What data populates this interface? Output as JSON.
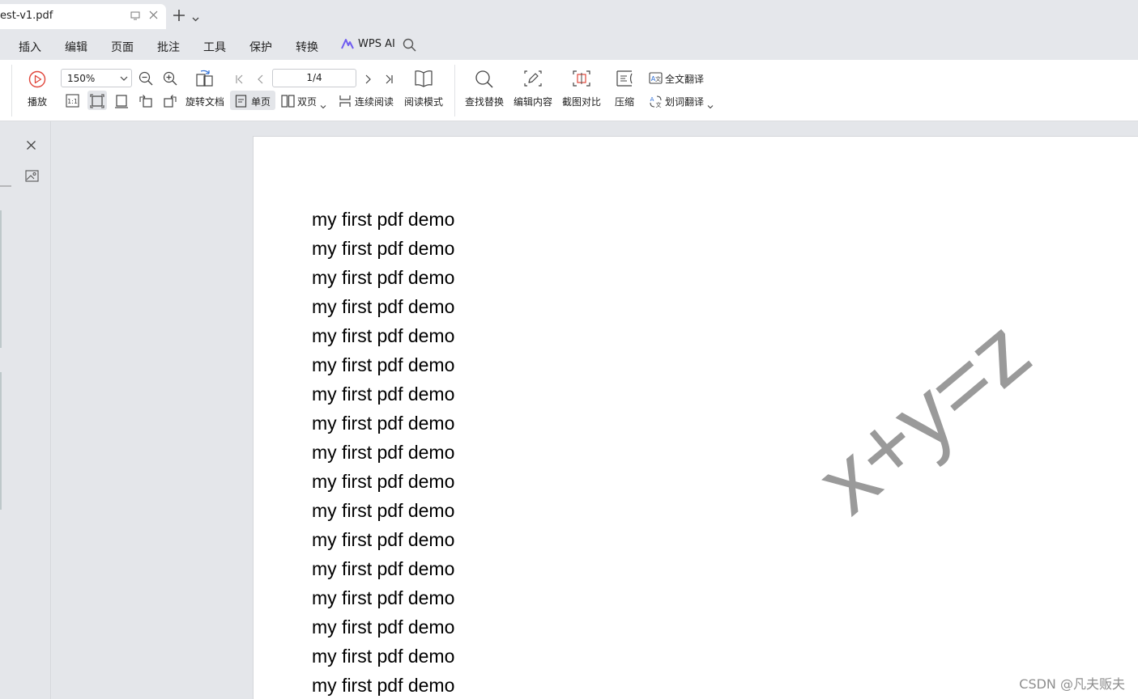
{
  "tab": {
    "title": "est-v1.pdf"
  },
  "menu": {
    "items": [
      "插入",
      "编辑",
      "页面",
      "批注",
      "工具",
      "保护",
      "转换"
    ],
    "ai_label": "WPS AI"
  },
  "toolbar": {
    "play_label": "播放",
    "zoom_value": "150%",
    "page_value": "1/4",
    "rotate_label": "旋转文档",
    "single_page_label": "单页",
    "double_page_label": "双页",
    "continuous_label": "连续阅读",
    "reading_mode_label": "阅读模式",
    "find_replace_label": "查找替换",
    "edit_content_label": "编辑内容",
    "screenshot_compare_label": "截图对比",
    "compress_label": "压缩",
    "full_translate_label": "全文翻译",
    "word_translate_label": "划词翻译"
  },
  "document": {
    "lines": [
      "my first pdf demo",
      "my first pdf demo",
      "my first pdf demo",
      "my first pdf demo",
      "my first pdf demo",
      "my first pdf demo",
      "my first pdf demo",
      "my first pdf demo",
      "my first pdf demo",
      "my first pdf demo",
      "my first pdf demo",
      "my first pdf demo",
      "my first pdf demo",
      "my first pdf demo",
      "my first pdf demo",
      "my first pdf demo",
      "my first pdf demo"
    ],
    "watermark": "x+y=z"
  },
  "credit": "CSDN @凡夫贩夫",
  "colors": {
    "watermark": "#9a9a9a",
    "ai_accent": "#6f5cf0",
    "play_icon": "#e0453a"
  }
}
